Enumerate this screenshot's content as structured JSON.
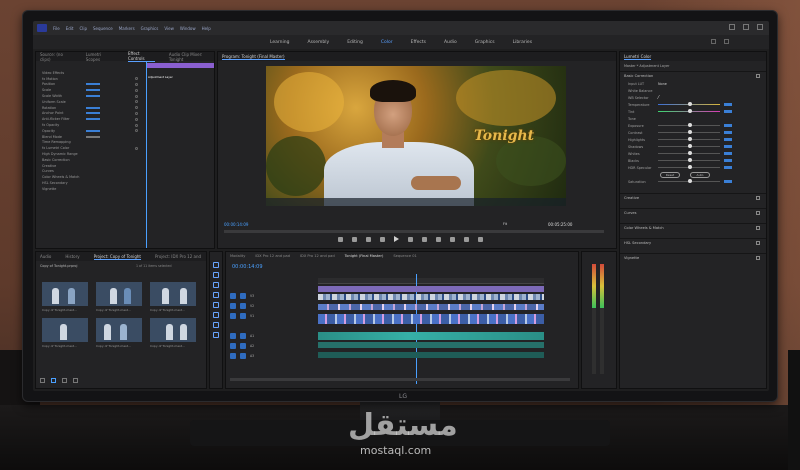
{
  "app": {
    "menu": [
      "Premiere",
      "File",
      "Edit",
      "Clip",
      "Sequence",
      "Markers",
      "Graphics",
      "View",
      "Window",
      "Help"
    ],
    "workspaces": [
      "Learning",
      "Assembly",
      "Editing",
      "Color",
      "Effects",
      "Audio",
      "Graphics",
      "Libraries"
    ],
    "active_workspace": "Color"
  },
  "source_panel": {
    "tabs": [
      "Source: (no clips)",
      "Lumetri Scopes",
      "Effect Controls",
      "Audio Clip Mixer: Tonight"
    ],
    "active_tab": "Effect Controls",
    "clip_label": "Adjustment Layer",
    "rows": [
      "Video Effects",
      "fx Motion",
      "Position",
      "Scale",
      "Scale Width",
      "Uniform Scale",
      "Rotation",
      "Anchor Point",
      "Anti-flicker Filter",
      "fx Opacity",
      "Opacity",
      "Blend Mode",
      "Time Remapping",
      "fx Lumetri Color",
      "High Dynamic Range",
      "Basic Correction",
      "Creative",
      "Curves",
      "Color Wheels & Match",
      "HSL Secondary",
      "Vignette"
    ]
  },
  "program_monitor": {
    "title": "Program: Tonight (Final Master)",
    "overlay_text": "Tonight",
    "timecode_left": "00:00:14:09",
    "timecode_right": "00:05:25:00",
    "fit": "Fit",
    "quality": "Full"
  },
  "lumetri": {
    "title": "Lumetri Color",
    "clip": "Master * Adjustment Layer",
    "sections": [
      "Basic Correction",
      "Creative",
      "Curves",
      "Color Wheels & Match",
      "HSL Secondary",
      "Vignette"
    ],
    "sub": "White Balance",
    "wb_selector": "WB Selector",
    "rows": [
      "Temperature",
      "Tint",
      "Exposure",
      "Contrast",
      "Highlights",
      "Shadows",
      "Whites",
      "Blacks",
      "HDR Specular",
      "Saturation"
    ],
    "input_lut": "Input LUT",
    "input_lut_value": "None",
    "tone_label": "Tone",
    "buttons": [
      "Reset",
      "Auto"
    ]
  },
  "project_panel": {
    "tabs": [
      "Audio",
      "History",
      "Project: Copy of Tonight",
      "Project: IDX Pro 12 and"
    ],
    "active_tab": "Project: Copy of Tonight",
    "bin": "Copy of Tonight.prproj",
    "count": "1 of 11 items selected",
    "thumb_labels": [
      "Copy of Tonight-mast...",
      "Copy of Tonight-mast...",
      "Copy of Tonight-mast...",
      "Copy of Tonight-mast...",
      "Copy of Tonight-mast...",
      "Copy of Tonight-mast..."
    ]
  },
  "timeline": {
    "tabs": [
      "Modality",
      "IDX Pro 12 and pad",
      "IDX Pro 12 and pad",
      "Tonight (Final Master)",
      "Sequence 01"
    ],
    "active_tab": "Tonight (Final Master)",
    "timecode": "00:00:14:09",
    "tracks": [
      "V3",
      "V2",
      "V1",
      "A1",
      "A2",
      "A3"
    ]
  },
  "monitor_brand": "LG",
  "watermark": {
    "arabic": "مستقل",
    "latin": "mostaql.com"
  },
  "colors": {
    "accent": "#4aa0ff",
    "overlay_text": "#e7b84a",
    "panel": "#232325"
  }
}
